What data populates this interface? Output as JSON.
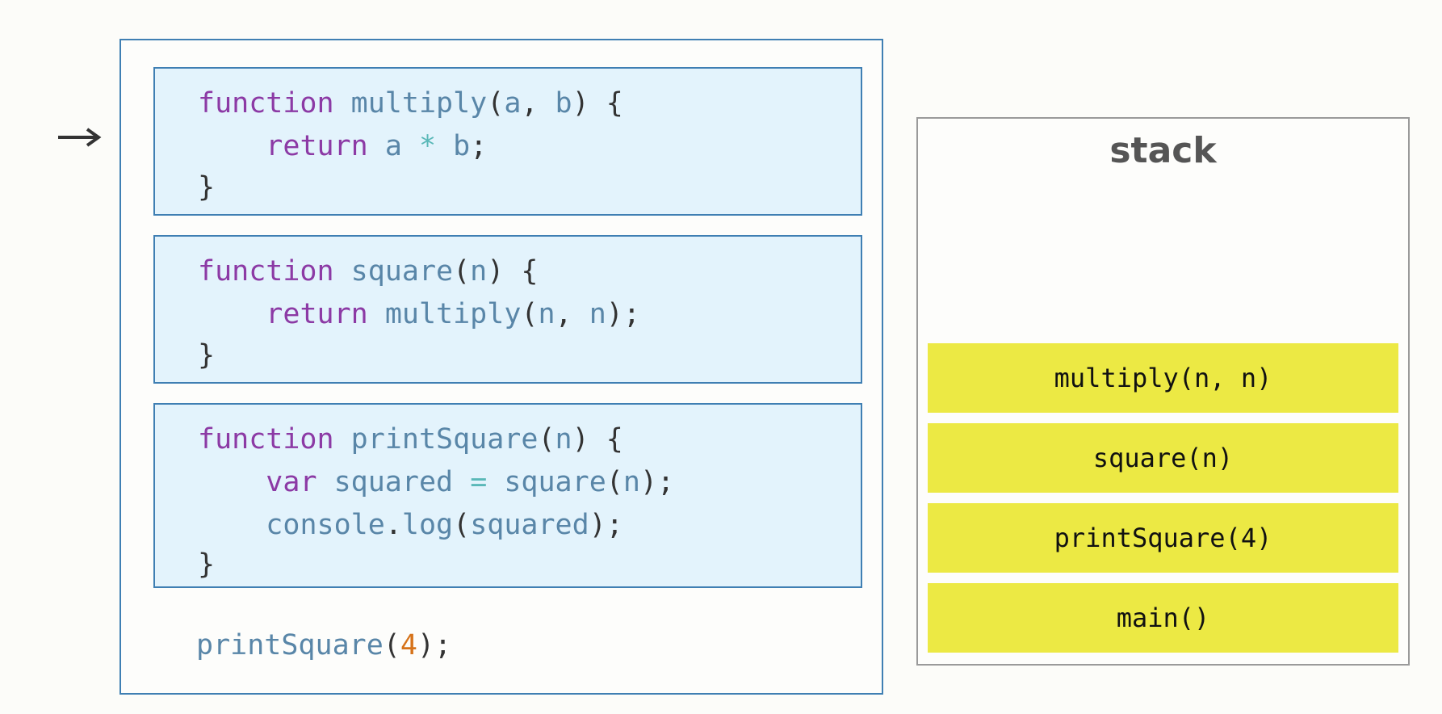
{
  "code": {
    "blocks": [
      {
        "name": "multiply",
        "lines": [
          [
            {
              "t": "function",
              "c": "kw"
            },
            {
              "t": " ",
              "c": "pn"
            },
            {
              "t": "multiply",
              "c": "id"
            },
            {
              "t": "(",
              "c": "pn"
            },
            {
              "t": "a",
              "c": "id"
            },
            {
              "t": ", ",
              "c": "pn"
            },
            {
              "t": "b",
              "c": "id"
            },
            {
              "t": ") {",
              "c": "pn"
            }
          ],
          [
            {
              "t": "    ",
              "c": "pn"
            },
            {
              "t": "return",
              "c": "kw"
            },
            {
              "t": " ",
              "c": "pn"
            },
            {
              "t": "a",
              "c": "id"
            },
            {
              "t": " ",
              "c": "pn"
            },
            {
              "t": "*",
              "c": "op"
            },
            {
              "t": " ",
              "c": "pn"
            },
            {
              "t": "b",
              "c": "id"
            },
            {
              "t": ";",
              "c": "pn"
            }
          ],
          [
            {
              "t": "}",
              "c": "pn"
            }
          ]
        ]
      },
      {
        "name": "square",
        "lines": [
          [
            {
              "t": "function",
              "c": "kw"
            },
            {
              "t": " ",
              "c": "pn"
            },
            {
              "t": "square",
              "c": "id"
            },
            {
              "t": "(",
              "c": "pn"
            },
            {
              "t": "n",
              "c": "id"
            },
            {
              "t": ") {",
              "c": "pn"
            }
          ],
          [
            {
              "t": "    ",
              "c": "pn"
            },
            {
              "t": "return",
              "c": "kw"
            },
            {
              "t": " ",
              "c": "pn"
            },
            {
              "t": "multiply",
              "c": "id"
            },
            {
              "t": "(",
              "c": "pn"
            },
            {
              "t": "n",
              "c": "id"
            },
            {
              "t": ", ",
              "c": "pn"
            },
            {
              "t": "n",
              "c": "id"
            },
            {
              "t": ");",
              "c": "pn"
            }
          ],
          [
            {
              "t": "}",
              "c": "pn"
            }
          ]
        ]
      },
      {
        "name": "printSquare",
        "lines": [
          [
            {
              "t": "function",
              "c": "kw"
            },
            {
              "t": " ",
              "c": "pn"
            },
            {
              "t": "printSquare",
              "c": "id"
            },
            {
              "t": "(",
              "c": "pn"
            },
            {
              "t": "n",
              "c": "id"
            },
            {
              "t": ") {",
              "c": "pn"
            }
          ],
          [
            {
              "t": "    ",
              "c": "pn"
            },
            {
              "t": "var",
              "c": "kw"
            },
            {
              "t": " ",
              "c": "pn"
            },
            {
              "t": "squared",
              "c": "id"
            },
            {
              "t": " ",
              "c": "pn"
            },
            {
              "t": "=",
              "c": "op"
            },
            {
              "t": " ",
              "c": "pn"
            },
            {
              "t": "square",
              "c": "id"
            },
            {
              "t": "(",
              "c": "pn"
            },
            {
              "t": "n",
              "c": "id"
            },
            {
              "t": ");",
              "c": "pn"
            }
          ],
          [
            {
              "t": "    ",
              "c": "pn"
            },
            {
              "t": "console",
              "c": "id"
            },
            {
              "t": ".",
              "c": "pn"
            },
            {
              "t": "log",
              "c": "id"
            },
            {
              "t": "(",
              "c": "pn"
            },
            {
              "t": "squared",
              "c": "id"
            },
            {
              "t": ");",
              "c": "pn"
            }
          ],
          [
            {
              "t": "}",
              "c": "pn"
            }
          ]
        ]
      }
    ],
    "call": [
      {
        "t": "printSquare",
        "c": "id"
      },
      {
        "t": "(",
        "c": "pn"
      },
      {
        "t": "4",
        "c": "num"
      },
      {
        "t": ");",
        "c": "pn"
      }
    ]
  },
  "stack": {
    "title": "stack",
    "frames": [
      "multiply(n, n)",
      "square(n)",
      "printSquare(4)",
      "main()"
    ]
  },
  "colors": {
    "keyword": "#8c3aa5",
    "identifier": "#5986a8",
    "operator": "#5ab8b8",
    "number": "#d6731a",
    "block_bg": "#e3f3fc",
    "block_border": "#3f7fb3",
    "frame_bg": "#ece944"
  }
}
